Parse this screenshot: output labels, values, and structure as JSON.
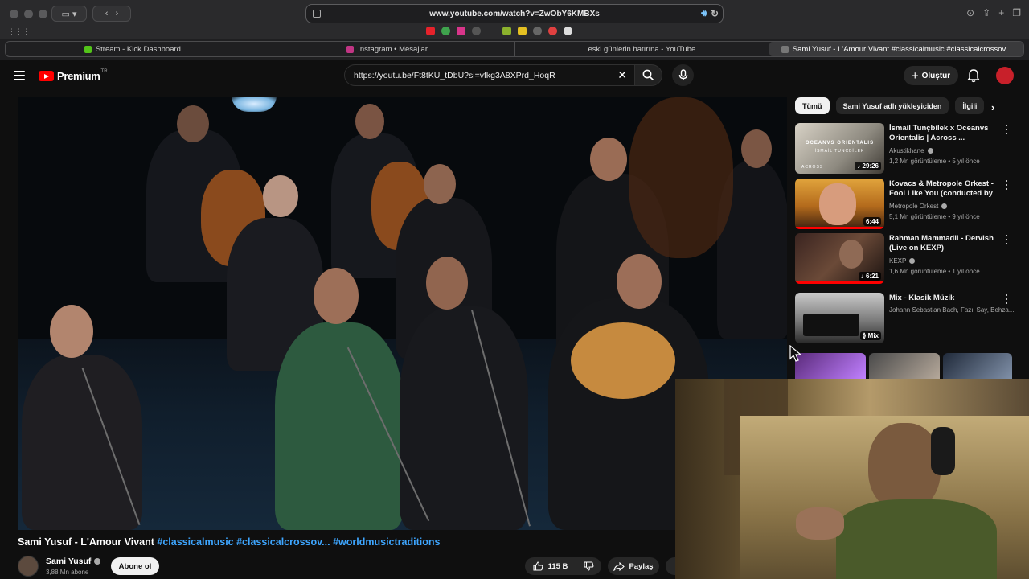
{
  "browser": {
    "url": "www.youtube.com/watch?v=ZwObY6KMBXs",
    "tabs": [
      {
        "label": "Stream - Kick Dashboard",
        "active": false
      },
      {
        "label": "Instagram • Mesajlar",
        "active": false
      },
      {
        "label": "eski günlerin hatırına - YouTube",
        "active": false
      },
      {
        "label": "Sami Yusuf - L'Amour Vivant #classicalmusic #classicalcrossov...",
        "active": true
      }
    ]
  },
  "header": {
    "logo_text": "Premium",
    "logo_superscript": "TR",
    "search_value": "https://youtu.be/Ft8tKU_tDbU?si=vfkg3A8XPrd_HoqR",
    "create_label": "Oluştur",
    "brand_color": "#ff0000"
  },
  "video": {
    "title": "Sami Yusuf - L'Amour Vivant",
    "hashtags": "#classicalmusic #classicalcrossov...",
    "hashtag_last": "#worldmusictraditions",
    "channel_name": "Sami Yusuf",
    "subscribers": "3,88 Mn abone",
    "subscribe_label": "Abone ol",
    "likes": "115 B",
    "share_label": "Paylaş"
  },
  "sidebar": {
    "chips": [
      "Tümü",
      "Sami Yusuf adlı yükleyiciden",
      "İlgili"
    ],
    "recommendations": [
      {
        "title": "İsmail Tunçbilek x Oceanvs Orientalis | Across ...",
        "channel": "Akustikhane",
        "meta": "1,2 Mn görüntüleme • 5 yıl önce",
        "duration": "29:26",
        "progress": 0.0
      },
      {
        "title": "Kovacs & Metropole Orkest - Fool Like You (conducted by ...",
        "channel": "Metropole Orkest",
        "meta": "5,1 Mn görüntüleme • 9 yıl önce",
        "duration": "6:44",
        "progress": 1.0
      },
      {
        "title": "Rahman Mammadli - Dervish (Live on KEXP)",
        "channel": "KEXP",
        "meta": "1,6 Mn görüntüleme • 1 yıl önce",
        "duration": "6:21",
        "progress": 1.0
      },
      {
        "title": "Mix - Klasik Müzik",
        "channel": "Johann Sebastian Bach, Fazıl Say, Behza...",
        "meta": "",
        "duration": "Mix",
        "progress": 0.0
      }
    ],
    "thumb_text_1": "OCEANVS ORIENTALIS",
    "thumb_text_2": "İSMAİL TUNÇBİLEK",
    "thumb_text_3": "ACROSS"
  }
}
